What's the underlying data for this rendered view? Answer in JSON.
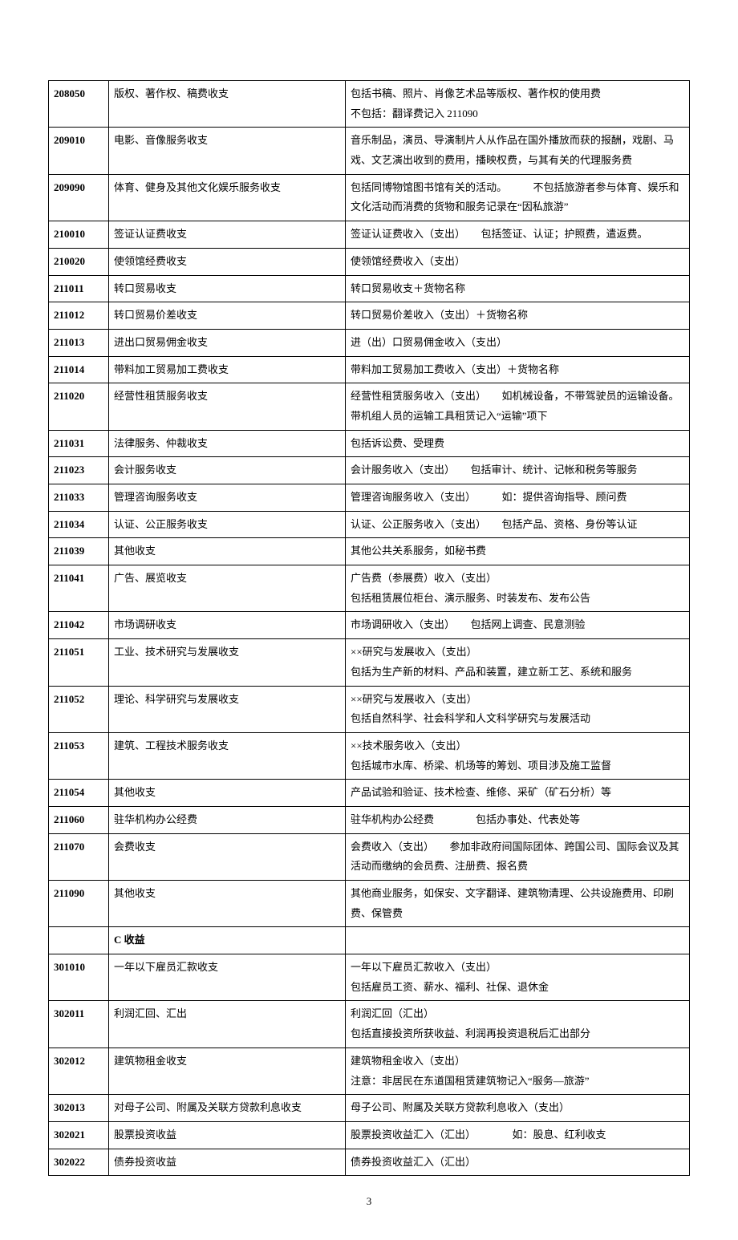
{
  "page_number": "3",
  "rows": [
    {
      "code": "208050",
      "name": "版权、著作权、稿费收支",
      "desc": "包括书稿、照片、肖像艺术品等版权、著作权的使用费\n不包括：翻译费记入 211090"
    },
    {
      "code": "209010",
      "name": "电影、音像服务收支",
      "desc": "音乐制品，演员、导演制片人从作品在国外播放而获的报酬，戏剧、马戏、文艺演出收到的费用，播映权费，与其有关的代理服务费"
    },
    {
      "code": "209090",
      "name": "体育、健身及其他文化娱乐服务收支",
      "desc": "包括同博物馆图书馆有关的活动。　　　不包括旅游者参与体育、娱乐和文化活动而消费的货物和服务记录在“因私旅游”"
    },
    {
      "code": "210010",
      "name": "签证认证费收支",
      "desc": "签证认证费收入（支出）　　包括签证、认证；护照费，遣返费。"
    },
    {
      "code": "210020",
      "name": "使领馆经费收支",
      "desc": "使领馆经费收入（支出）"
    },
    {
      "code": "211011",
      "name": "转口贸易收支",
      "desc": "转口贸易收支＋货物名称"
    },
    {
      "code": "211012",
      "name": "转口贸易价差收支",
      "desc": "转口贸易价差收入（支出）＋货物名称"
    },
    {
      "code": "211013",
      "name": "进出口贸易佣金收支",
      "desc": "进（出）口贸易佣金收入（支出）"
    },
    {
      "code": "211014",
      "name": "带料加工贸易加工费收支",
      "desc": "带料加工贸易加工费收入（支出）＋货物名称"
    },
    {
      "code": "211020",
      "name": "经营性租赁服务收支",
      "desc": "经营性租赁服务收入（支出）　　如机械设备，不带驾驶员的运输设备。带机组人员的运输工具租赁记入“运输”项下"
    },
    {
      "code": "211031",
      "name": "法律服务、仲裁收支",
      "desc": "包括诉讼费、受理费"
    },
    {
      "code": "211023",
      "name": "会计服务收支",
      "desc": "会计服务收入（支出）　　包括审计、统计、记帐和税务等服务"
    },
    {
      "code": "211033",
      "name": "管理咨询服务收支",
      "desc": "管理咨询服务收入（支出）　　　如：提供咨询指导、顾问费"
    },
    {
      "code": "211034",
      "name": "认证、公正服务收支",
      "desc": "认证、公正服务收入（支出）　　包括产品、资格、身份等认证"
    },
    {
      "code": "211039",
      "name": "其他收支",
      "desc": "其他公共关系服务，如秘书费"
    },
    {
      "code": "211041",
      "name": "广告、展览收支",
      "desc": "广告费（参展费）收入（支出）\n包括租赁展位柜台、演示服务、时装发布、发布公告"
    },
    {
      "code": "211042",
      "name": "市场调研收支",
      "desc": "市场调研收入（支出）　　包括网上调查、民意测验"
    },
    {
      "code": "211051",
      "name": "工业、技术研究与发展收支",
      "desc": "××研究与发展收入（支出）\n包括为生产新的材料、产品和装置，建立新工艺、系统和服务"
    },
    {
      "code": "211052",
      "name": "理论、科学研究与发展收支",
      "desc": "××研究与发展收入（支出）\n包括自然科学、社会科学和人文科学研究与发展活动"
    },
    {
      "code": "211053",
      "name": "建筑、工程技术服务收支",
      "desc": "××技术服务收入（支出）\n包括城市水库、桥梁、机场等的筹划、项目涉及施工监督"
    },
    {
      "code": "211054",
      "name": "其他收支",
      "desc": "产品试验和验证、技术检查、维修、采矿（矿石分析）等"
    },
    {
      "code": "211060",
      "name": "驻华机构办公经费",
      "desc": "驻华机构办公经费　　　　包括办事处、代表处等"
    },
    {
      "code": "211070",
      "name": "会费收支",
      "desc": "会费收入（支出）　　参加非政府间国际团体、跨国公司、国际会议及其活动而缴纳的会员费、注册费、报名费"
    },
    {
      "code": "211090",
      "name": "其他收支",
      "desc": "其他商业服务，如保安、文字翻译、建筑物清理、公共设施费用、印刷费、保管费"
    },
    {
      "code": "",
      "name": "C 收益",
      "desc": "",
      "section": true
    },
    {
      "code": "301010",
      "name": "一年以下雇员汇款收支",
      "desc": "一年以下雇员汇款收入（支出）\n包括雇员工资、薪水、福利、社保、退休金"
    },
    {
      "code": "302011",
      "name": "利润汇回、汇出",
      "desc": "利润汇回（汇出）\n包括直接投资所获收益、利润再投资退税后汇出部分"
    },
    {
      "code": "302012",
      "name": "建筑物租金收支",
      "desc": "建筑物租金收入（支出）\n注意：非居民在东道国租赁建筑物记入“服务—旅游”"
    },
    {
      "code": "302013",
      "name": "对母子公司、附属及关联方贷款利息收支",
      "desc": "母子公司、附属及关联方贷款利息收入（支出）"
    },
    {
      "code": "302021",
      "name": "股票投资收益",
      "desc": "股票投资收益汇入（汇出）　　　　如：股息、红利收支"
    },
    {
      "code": "302022",
      "name": "债券投资收益",
      "desc": "债券投资收益汇入（汇出）"
    }
  ]
}
